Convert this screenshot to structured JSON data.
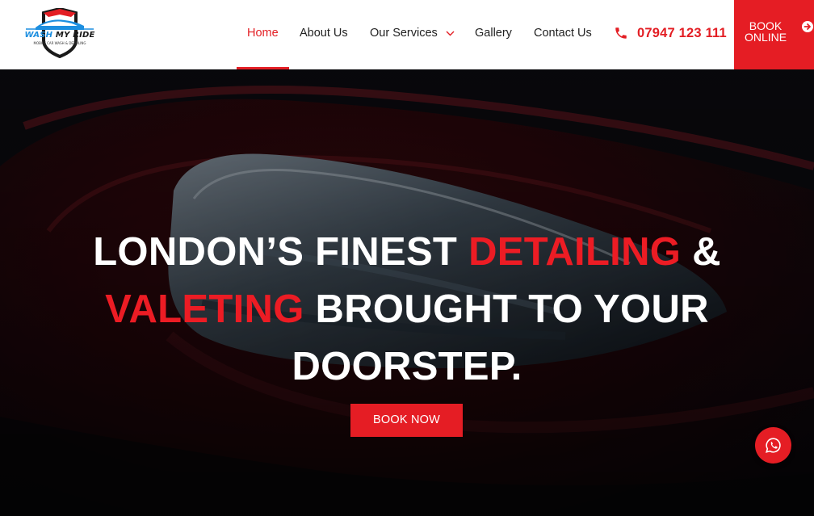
{
  "brand": {
    "wordmark_part1": "WASH",
    "wordmark_part2": "MY RIDE",
    "tagline": "MOBILE CAR WASH & DETAILING"
  },
  "nav": {
    "items": [
      {
        "label": "Home",
        "active": true
      },
      {
        "label": "About Us",
        "active": false
      },
      {
        "label": "Our Services",
        "active": false
      },
      {
        "label": "Gallery",
        "active": false
      },
      {
        "label": "Contact Us",
        "active": false
      }
    ]
  },
  "contact": {
    "phone": "07947 123 111",
    "phone_icon": "phone-icon"
  },
  "header_cta": {
    "label_line1": "BOOK",
    "label_line2": "ONLINE",
    "icon": "arrow-right-circle-icon"
  },
  "hero": {
    "title_part1": "LONDON’S FINEST ",
    "title_highlight1": "DETAILING",
    "title_part2": " &",
    "title_highlight2": "VALETING",
    "title_part3": " BROUGHT TO YOUR",
    "title_part4": "DOORSTEP.",
    "cta_label": "BOOK NOW"
  },
  "floating": {
    "whatsapp_icon": "whatsapp-icon"
  },
  "colors": {
    "accent": "#e51d24",
    "nav_text": "#222222",
    "hero_text": "#ffffff"
  }
}
